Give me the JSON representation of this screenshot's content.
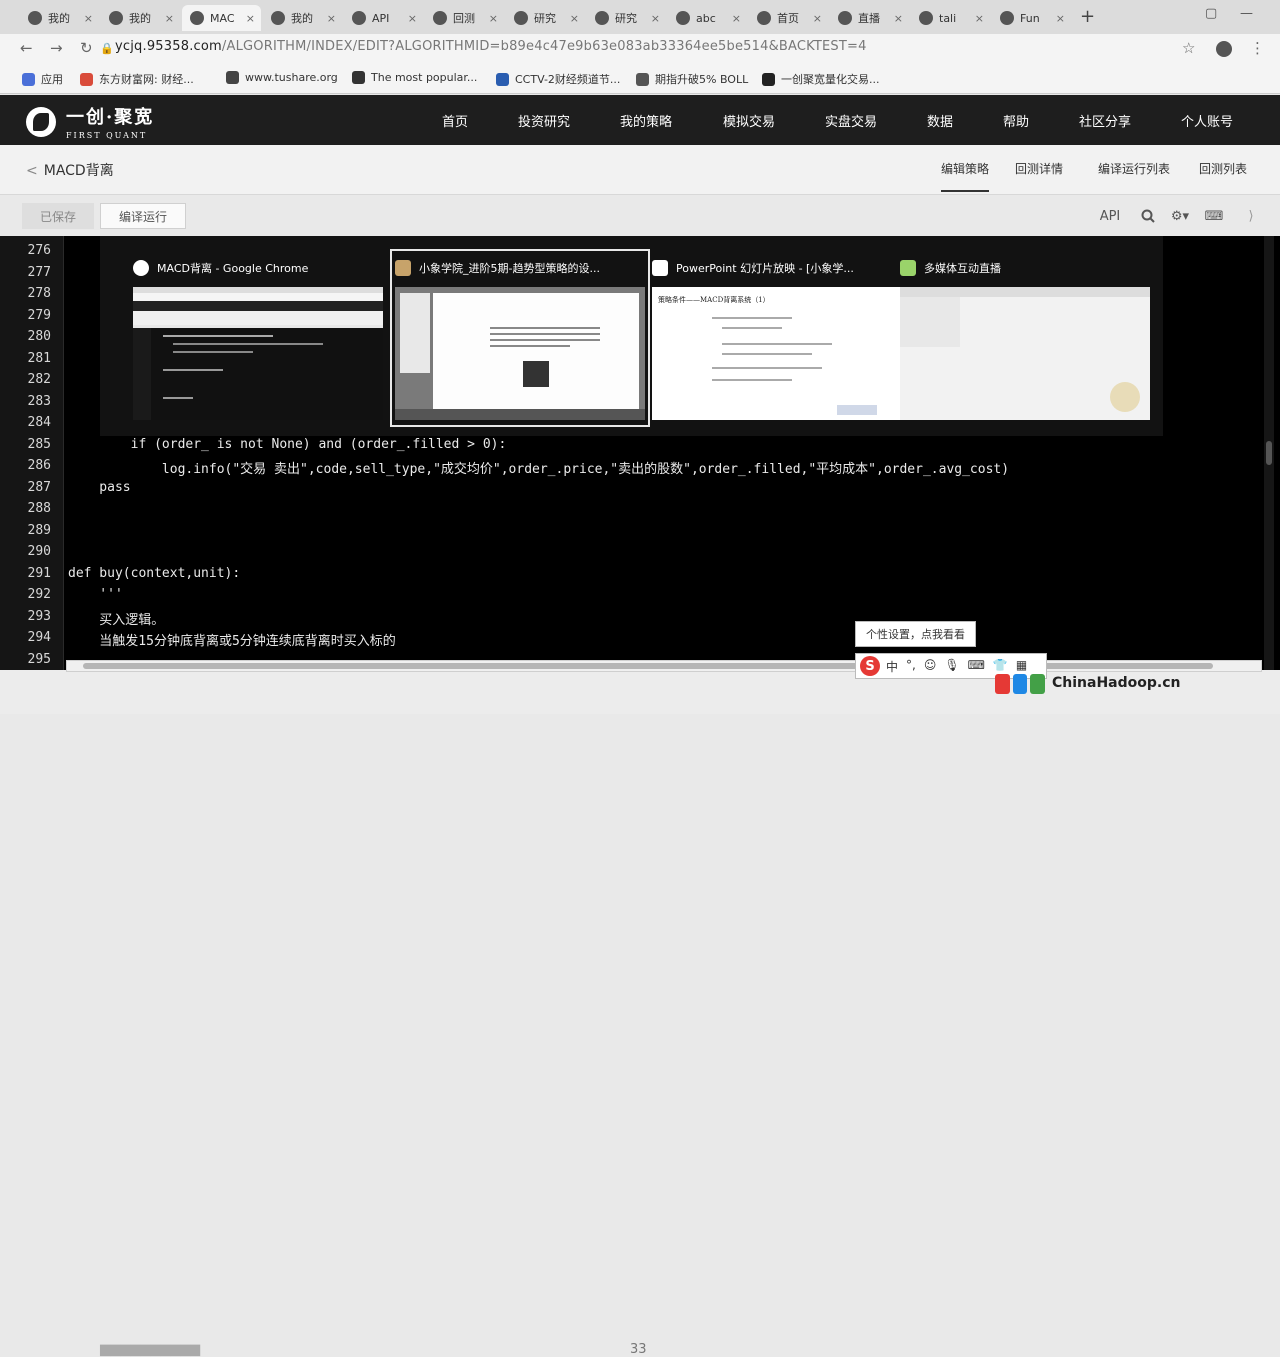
{
  "browser": {
    "tabs": [
      {
        "label": "我的",
        "icon": "sogou-icon"
      },
      {
        "label": "我的",
        "icon": "sogou-icon"
      },
      {
        "label": "MAC",
        "icon": "firstquant-icon"
      },
      {
        "label": "我的",
        "icon": "sogou-icon"
      },
      {
        "label": "API",
        "icon": "doc-icon"
      },
      {
        "label": "回测",
        "icon": "doc-icon"
      },
      {
        "label": "研究",
        "icon": "doc-icon"
      },
      {
        "label": "研究",
        "icon": "doc-icon"
      },
      {
        "label": "abc",
        "icon": "globe-icon"
      },
      {
        "label": "首页",
        "icon": "page-icon"
      },
      {
        "label": "直播",
        "icon": "page-icon"
      },
      {
        "label": "tali",
        "icon": "paw-icon"
      },
      {
        "label": "Fun",
        "icon": "diamond-icon"
      }
    ],
    "active_tab": 2,
    "url_host": "ycjq.95358.com",
    "url_path": "/ALGORITHM/INDEX/EDIT?ALGORITHMID=b89e4c47e9b63e083ab33364ee5be514&BACKTEST=4",
    "bookmarks": [
      {
        "label": "应用",
        "color": "#4a6fd8"
      },
      {
        "label": "东方财富网: 财经...",
        "color": "#d94b3a"
      },
      {
        "label": "www.tushare.org",
        "color": "#444444"
      },
      {
        "label": "The most popular...",
        "color": "#333333"
      },
      {
        "label": "CCTV-2财经频道节...",
        "color": "#2a5db0"
      },
      {
        "label": "期指升破5% BOLL",
        "color": "#555555"
      },
      {
        "label": "一创聚宽量化交易...",
        "color": "#222222"
      }
    ]
  },
  "site": {
    "logo_cn": "一创·聚宽",
    "logo_en": "FIRST QUANT",
    "nav": [
      "首页",
      "投资研究",
      "我的策略",
      "模拟交易",
      "实盘交易",
      "数据",
      "帮助",
      "社区分享",
      "个人账号"
    ]
  },
  "strategy": {
    "back": "<",
    "title": "MACD背离",
    "tabs": [
      "编辑策略",
      "回测详情",
      "编译运行列表",
      "回测列表"
    ],
    "active_tab": 0,
    "saved_label": "已保存",
    "run_label": "编译运行",
    "api_label": "API"
  },
  "editor": {
    "lines": [
      {
        "n": "276",
        "code": ""
      },
      {
        "n": "277",
        "code": ""
      },
      {
        "n": "278",
        "code": ""
      },
      {
        "n": "279",
        "code": ""
      },
      {
        "n": "280",
        "code": ""
      },
      {
        "n": "281",
        "code": ""
      },
      {
        "n": "282",
        "code": ""
      },
      {
        "n": "283",
        "code": ""
      },
      {
        "n": "284",
        "code": ""
      },
      {
        "n": "285",
        "code": "        if (order_ is not None) and (order_.filled > 0):"
      },
      {
        "n": "286",
        "code": "            log.info(\"交易 卖出\",code,sell_type,\"成交均价\",order_.price,\"卖出的股数\",order_.filled,\"平均成本\",order_.avg_cost)"
      },
      {
        "n": "287",
        "code": "    pass"
      },
      {
        "n": "288",
        "code": ""
      },
      {
        "n": "289",
        "code": ""
      },
      {
        "n": "290",
        "code": ""
      },
      {
        "n": "291",
        "code": "def buy(context,unit):"
      },
      {
        "n": "292",
        "code": "    '''"
      },
      {
        "n": "293",
        "code": "    买入逻辑。"
      },
      {
        "n": "294",
        "code": "    当触发15分钟底背离或5分钟连续底背离时买入标的"
      },
      {
        "n": "295",
        "code": ""
      }
    ]
  },
  "switcher": {
    "windows": [
      {
        "title": "MACD背离 - Google Chrome",
        "icon_color": "#ffffff"
      },
      {
        "title": "小象学院_进阶5期-趋势型策略的设...",
        "icon_color": "#c7a36a"
      },
      {
        "title": "PowerPoint 幻灯片放映 - [小象学...",
        "icon_color": "#ffffff"
      },
      {
        "title": "多媒体互动直播",
        "icon_color": "#9ad36a"
      }
    ],
    "selected": 1,
    "slide_heading": "策略条件——MACD背离系统（1）"
  },
  "ime": {
    "tip": "个性设置，点我看看",
    "items": [
      "中",
      "°,",
      "☺",
      "🎙",
      "⌨",
      "👕",
      "▦"
    ]
  },
  "watermark": "ChinaHadoop.cn",
  "bottom_page": "33"
}
